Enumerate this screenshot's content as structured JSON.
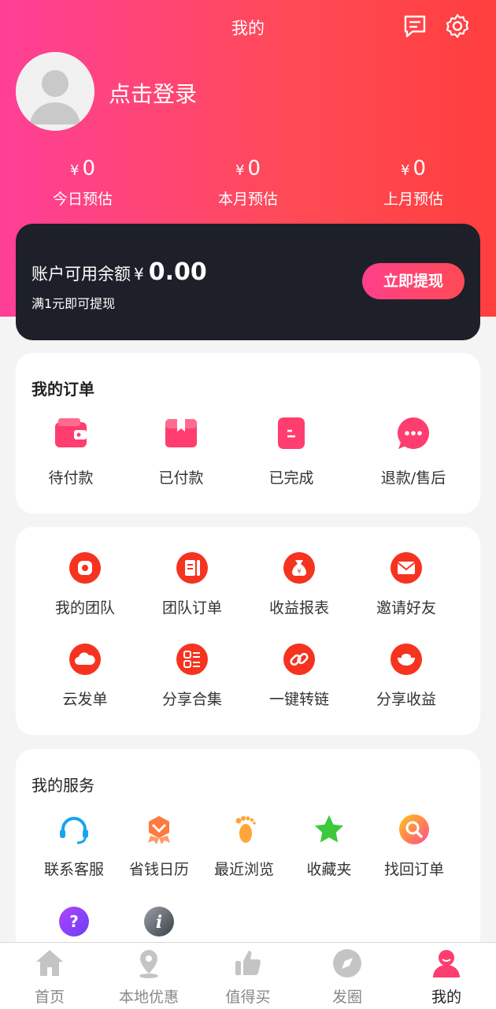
{
  "header": {
    "title": "我的",
    "message_icon": "message-icon",
    "settings_icon": "gear-icon"
  },
  "profile": {
    "login_text": "点击登录",
    "avatar_icon": "avatar-placeholder"
  },
  "stats": [
    {
      "currency": "¥",
      "value": "0",
      "label": "今日预估"
    },
    {
      "currency": "¥",
      "value": "0",
      "label": "本月预估"
    },
    {
      "currency": "¥",
      "value": "0",
      "label": "上月预估"
    }
  ],
  "balance": {
    "label": "账户可用余额",
    "currency": "¥",
    "amount": "0.00",
    "note": "满1元即可提现",
    "button": "立即提现"
  },
  "orders": {
    "title": "我的订单",
    "items": [
      {
        "label": "待付款",
        "icon": "wallet-icon"
      },
      {
        "label": "已付款",
        "icon": "package-icon"
      },
      {
        "label": "已完成",
        "icon": "receipt-icon"
      },
      {
        "label": "退款/售后",
        "icon": "chat-bubble-icon"
      }
    ]
  },
  "tools": {
    "items": [
      {
        "label": "我的团队",
        "icon": "team-icon"
      },
      {
        "label": "团队订单",
        "icon": "order-doc-icon"
      },
      {
        "label": "收益报表",
        "icon": "money-bag-icon"
      },
      {
        "label": "邀请好友",
        "icon": "envelope-icon"
      },
      {
        "label": "云发单",
        "icon": "cloud-icon"
      },
      {
        "label": "分享合集",
        "icon": "list-icon"
      },
      {
        "label": "一键转链",
        "icon": "link-icon"
      },
      {
        "label": "分享收益",
        "icon": "ingot-icon"
      }
    ]
  },
  "services": {
    "title": "我的服务",
    "items": [
      {
        "label": "联系客服",
        "icon": "headset-icon"
      },
      {
        "label": "省钱日历",
        "icon": "medal-icon"
      },
      {
        "label": "最近浏览",
        "icon": "footprint-icon"
      },
      {
        "label": "收藏夹",
        "icon": "star-icon"
      },
      {
        "label": "找回订单",
        "icon": "search-order-icon"
      },
      {
        "label": "",
        "icon": "question-icon"
      },
      {
        "label": "",
        "icon": "info-icon"
      }
    ]
  },
  "tabbar": [
    {
      "label": "首页",
      "icon": "home-icon"
    },
    {
      "label": "本地优惠",
      "icon": "location-pin-icon"
    },
    {
      "label": "值得买",
      "icon": "thumbs-up-icon"
    },
    {
      "label": "发圈",
      "icon": "compass-icon"
    },
    {
      "label": "我的",
      "icon": "person-icon",
      "active": true
    }
  ],
  "colors": {
    "brand_pink": "#ff3f97",
    "brand_red": "#ff3e3e",
    "balance_bg": "#1e2029",
    "tab_active": "#ff3d6e"
  }
}
